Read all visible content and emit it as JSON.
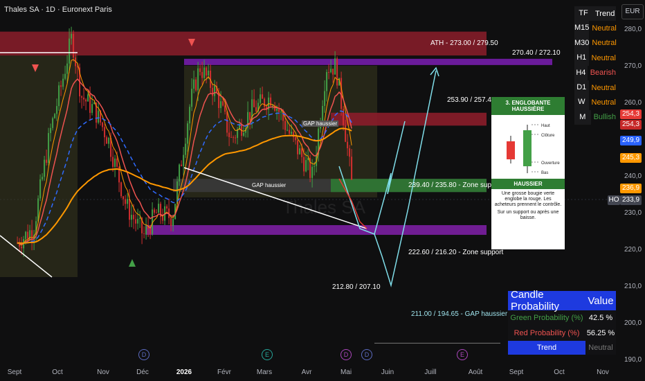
{
  "header": {
    "title": "Thales SA · 1D · Euronext Paris",
    "currency": "EUR",
    "watermark": "Thales SA"
  },
  "colors": {
    "bg": "#0f0f10",
    "up": "#43a047",
    "down": "#d32f2f",
    "ema_fast": "#ef5350",
    "ema_slow": "#ff9800",
    "ma_dash": "#2f6bff"
  },
  "price_axis": {
    "ticks": [
      "280,0",
      "270,0",
      "260,0",
      "250,0",
      "240,0",
      "230,0",
      "220,0",
      "210,0",
      "200,0",
      "190,0"
    ],
    "labels": [
      {
        "text": "254,3",
        "color": "#e53935"
      },
      {
        "text": "254,3",
        "color": "#c62828"
      },
      {
        "text": "249,9",
        "color": "#2962ff"
      },
      {
        "text": "245,3",
        "color": "#ff9800"
      },
      {
        "text": "236,9",
        "color": "#ff9800"
      },
      {
        "text": "HO",
        "color": "#434651"
      },
      {
        "text": "233,9",
        "color": "#434651"
      }
    ]
  },
  "time_axis": {
    "ticks": [
      "Sept",
      "Oct",
      "Nov",
      "Déc",
      "2026",
      "Févr",
      "Mars",
      "Avr",
      "Mai",
      "Juin",
      "Juill",
      "Août",
      "Sept",
      "Oct",
      "Nov"
    ],
    "events": [
      "D",
      "E",
      "D",
      "D",
      "E"
    ]
  },
  "zones": {
    "ath": "ATH - 273.00 / 279.50",
    "z1": "270.40 / 272.10",
    "z2": "253.90 / 257.40",
    "z3": "239.40 / 235.80 - Zone support",
    "gap1": "GAP haussier",
    "gap2": "GAP haussier",
    "z4": "222.60 / 216.20 - Zone support",
    "z5": "212.80 / 207.10",
    "z6": "211.00 / 194.65 - GAP haussier"
  },
  "trend_table": {
    "header": [
      "TF",
      "Trend"
    ],
    "rows": [
      {
        "tf": "M15",
        "trend": "Neutral",
        "color": "#ff9800"
      },
      {
        "tf": "M30",
        "trend": "Neutral",
        "color": "#ff9800"
      },
      {
        "tf": "H1",
        "trend": "Neutral",
        "color": "#ff9800"
      },
      {
        "tf": "H4",
        "trend": "Bearish",
        "color": "#ef5350"
      },
      {
        "tf": "D1",
        "trend": "Neutral",
        "color": "#ff9800"
      },
      {
        "tf": "W",
        "trend": "Neutral",
        "color": "#ff9800"
      },
      {
        "tf": "M",
        "trend": "Bullish",
        "color": "#43a047"
      }
    ]
  },
  "probability_table": {
    "header": [
      "Candle Probability",
      "Value"
    ],
    "green_label": "Green Probability (%)",
    "green_value": "42.5 %",
    "red_label": "Red Probability (%)",
    "red_value": "56.25 %",
    "trend_label": "Trend",
    "trend_value": "Neutral"
  },
  "pattern_card": {
    "title": "3. ENGLOBANTE HAUSSIÈRE",
    "labels": [
      "Haut",
      "Clôture",
      "Ouverture",
      "Bas"
    ],
    "subtitle": "HAUSSIER",
    "text1": "Une grosse bougie verte englobe la rouge. Les acheteurs prennent le contrôle.",
    "text2": "Sur un support ou après une baisse."
  },
  "chart_data": {
    "type": "candlestick",
    "title": "Thales SA · 1D · Euronext Paris",
    "ylim": [
      190,
      285
    ],
    "x_range": [
      "Sept 2025",
      "Nov 2026"
    ],
    "price_levels": {
      "ath": [
        273.0,
        279.5
      ],
      "r1": [
        270.4,
        272.1
      ],
      "r2": [
        253.9,
        257.4
      ],
      "s1": [
        235.8,
        239.4
      ],
      "s2": [
        216.2,
        222.6
      ],
      "s3": [
        207.1,
        212.8
      ],
      "gap": [
        194.65,
        211.0
      ]
    },
    "last_price": 233.9,
    "close_path": [
      [
        "Aug 28",
        222
      ],
      [
        "Sep 10",
        226
      ],
      [
        "Sep 22",
        252
      ],
      [
        "Oct 1",
        266
      ],
      [
        "Oct 8",
        278
      ],
      [
        "Oct 15",
        262
      ],
      [
        "Oct 25",
        258
      ],
      [
        "Nov 5",
        250
      ],
      [
        "Nov 18",
        232
      ],
      [
        "Dec 1",
        224
      ],
      [
        "Dec 10",
        230
      ],
      [
        "Dec 22",
        229
      ],
      [
        "Jan 5",
        260
      ],
      [
        "Jan 12",
        270
      ],
      [
        "Jan 25",
        262
      ],
      [
        "Feb 5",
        250
      ],
      [
        "Feb 20",
        258
      ],
      [
        "Mar 5",
        262
      ],
      [
        "Mar 20",
        250
      ],
      [
        "Apr 5",
        240
      ],
      [
        "Apr 15",
        270
      ],
      [
        "Apr 22",
        270
      ],
      [
        "Apr 28",
        255
      ],
      [
        "May 5",
        233.9
      ]
    ]
  }
}
